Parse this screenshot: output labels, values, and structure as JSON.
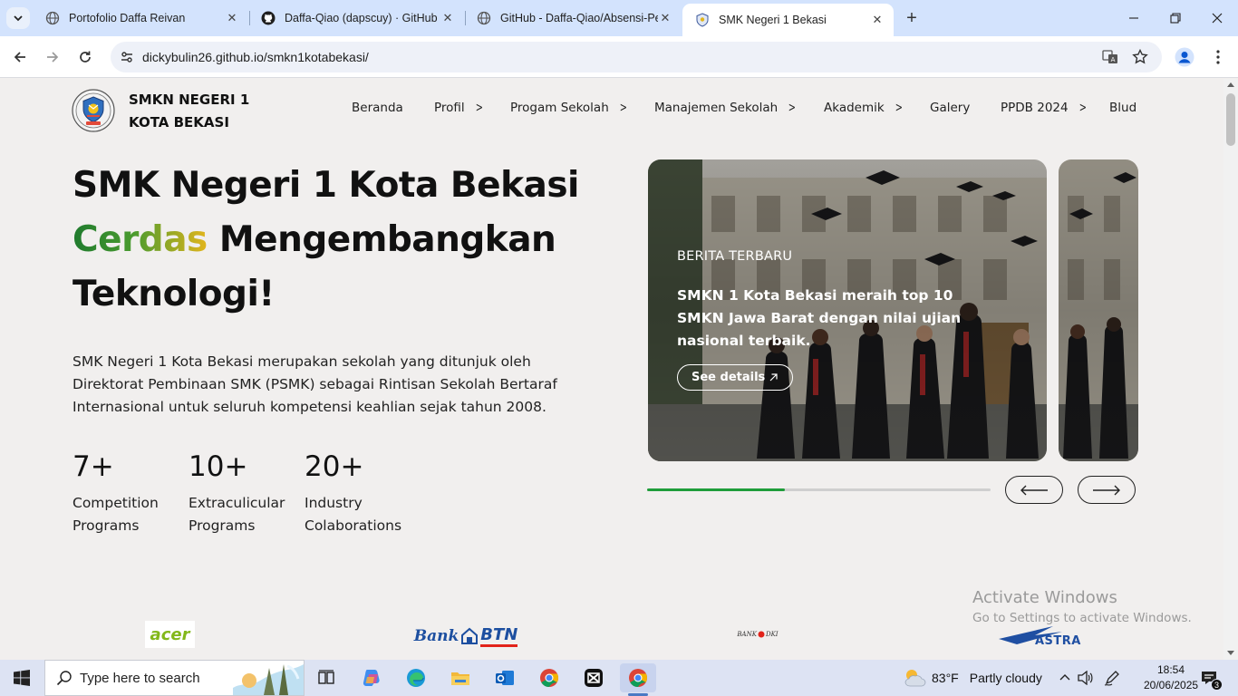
{
  "browser": {
    "tabs": [
      {
        "title": "Portofolio Daffa Reivan",
        "icon": "globe-icon"
      },
      {
        "title": "Daffa-Qiao (dapscuy) · GitHub",
        "icon": "github-icon"
      },
      {
        "title": "GitHub - Daffa-Qiao/Absensi-Pe",
        "icon": "globe-icon"
      },
      {
        "title": "SMK Negeri 1 Bekasi",
        "icon": "school-crest-icon",
        "active": true
      }
    ],
    "url": "dickybulin26.github.io/smkn1kotabekasi/"
  },
  "site": {
    "brand_line1": "SMKN NEGERI 1",
    "brand_line2": "KOTA BEKASI",
    "nav": [
      {
        "label": "Beranda",
        "has_submenu": false
      },
      {
        "label": "Profil",
        "has_submenu": true
      },
      {
        "label": "Progam Sekolah",
        "has_submenu": true
      },
      {
        "label": "Manajemen Sekolah",
        "has_submenu": true
      },
      {
        "label": "Akademik",
        "has_submenu": true
      },
      {
        "label": "Galery",
        "has_submenu": false
      },
      {
        "label": "PPDB 2024",
        "has_submenu": true
      },
      {
        "label": "Blud",
        "has_submenu": false
      }
    ],
    "chevron": ">",
    "hero": {
      "title_line1": "SMK Negeri 1 Kota Bekasi",
      "title_accent": "Cerdas",
      "title_rest": " Mengembangkan",
      "title_line3": "Teknologi!",
      "description": "SMK Negeri 1 Kota Bekasi merupakan sekolah yang ditunjuk oleh Direktorat Pembinaan SMK (PSMK) sebagai Rintisan Sekolah Bertaraf Internasional untuk seluruh kompetensi keahlian sejak tahun 2008."
    },
    "stats": [
      {
        "value": "7+",
        "label_line1": "Competition",
        "label_line2": "Programs"
      },
      {
        "value": "10+",
        "label_line1": "Extraculicular",
        "label_line2": "Programs"
      },
      {
        "value": "20+",
        "label_line1": "Industry",
        "label_line2": "Colaborations"
      }
    ],
    "slider": {
      "tag": "BERITA TERBARU",
      "headline": "SMKN 1 Kota Bekasi meraih top 10 SMKN Jawa Barat dengan nilai ujian nasional terbaik.",
      "button_label": "See details",
      "progress_fraction": 0.4
    },
    "partners": [
      {
        "name": "acer"
      },
      {
        "name": "Bank BTN",
        "part1": "Bank",
        "part2": "BTN"
      },
      {
        "name": "BANK DKI",
        "part1": "BANK",
        "part2": "DKI"
      },
      {
        "name": "ASTRA"
      }
    ]
  },
  "watermark": {
    "line1": "Activate Windows",
    "line2": "Go to Settings to activate Windows."
  },
  "taskbar": {
    "search_placeholder": "Type here to search",
    "weather_temp": "83°F",
    "weather_desc": "Partly cloudy",
    "time": "18:54",
    "date": "20/06/2025",
    "notification_count": "3",
    "pinned": [
      "task-view-icon",
      "copilot-icon",
      "edge-icon",
      "file-explorer-icon",
      "outlook-icon",
      "chrome-icon",
      "capcut-icon",
      "chrome-icon"
    ]
  },
  "colors": {
    "accent_green": "#1f9d3a",
    "accent_gold": "#e3b51c",
    "tabstrip": "#d3e3fd",
    "taskbar": "#dde3f3"
  }
}
